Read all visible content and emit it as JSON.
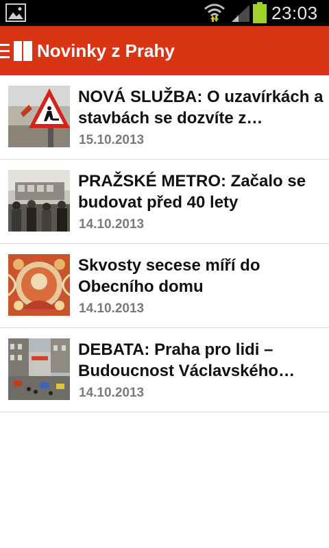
{
  "status_bar": {
    "time": "23:03",
    "icons": [
      "gallery-icon",
      "wifi-icon",
      "signal-icon",
      "battery-icon"
    ],
    "battery_color": "#9ed12a"
  },
  "app_bar": {
    "title": "Novinky z Prahy",
    "background": "#d93514",
    "icons": [
      "menu-icon"
    ]
  },
  "articles": [
    {
      "headline": "NOVÁ SLUŽBA: O uzavírkách a stavbách se dozvíte z…",
      "date": "15.10.2013",
      "thumbnail": "roadwork-sign-thumbnail"
    },
    {
      "headline": "PRAŽSKÉ METRO: Začalo se budovat před 40 lety",
      "date": "14.10.2013",
      "thumbnail": "crowd-tram-thumbnail"
    },
    {
      "headline": "Skvosty secese míří do Obecního domu",
      "date": "14.10.2013",
      "thumbnail": "art-nouveau-thumbnail"
    },
    {
      "headline": "DEBATA: Praha pro lidi – Budoucnost Václavského…",
      "date": "14.10.2013",
      "thumbnail": "square-street-thumbnail"
    }
  ]
}
